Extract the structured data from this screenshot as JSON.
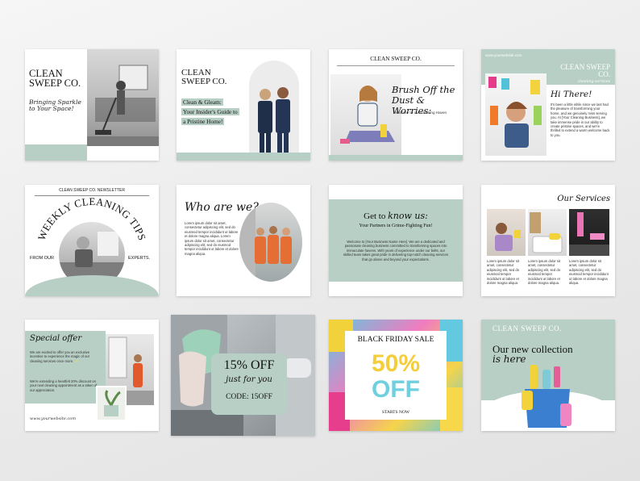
{
  "brand": "CLEAN SWEEP CO.",
  "brand_two_line": [
    "CLEAN",
    "SWEEP CO."
  ],
  "website": "www.yourwebsite.com",
  "colors": {
    "sage": "#b8cfc6",
    "dark": "#222222",
    "pink": "#f08cc8",
    "yellow": "#f6d44a",
    "teal": "#7fcfd9"
  },
  "cards": {
    "c1": {
      "tagline": [
        "Bringing Sparkle",
        "to Your Space!"
      ]
    },
    "c2": {
      "lines": [
        "Clean & Gleam:",
        "Your Insider's Guide to",
        "a Pristine Home!"
      ]
    },
    "c3": {
      "heading": [
        "Brush Off the",
        "Dust & Worries:"
      ],
      "sub": "Welcome to our Cleaning Haven"
    },
    "c4": {
      "website": "www.yourwebsite.com",
      "brand": [
        "CLEAN SWEEP",
        "CO."
      ],
      "sub": "cleaning services",
      "greeting": "Hi There!",
      "body": "It's been a little while since we last had the pleasure of transforming your home, and we genuinely miss serving you. At [Your Cleaning Business], we take immense pride in our ability to create pristine spaces, and we're thrilled to extend a warm welcome back to you."
    },
    "c5": {
      "header": "CLEAN SWEEP CO. NEWSLETTER",
      "arc_title": "WEEKLY CLEANING TIPS",
      "left": "FROM OUR",
      "right": "EXPERTS."
    },
    "c6": {
      "title": "Who are we?",
      "body": "Lorem ipsum dolor sit amet, consectetur adipiscing elit, sed do eiusmod tempor incididunt ut labore et dolore magna aliqua. Lorem ipsum dolor sit amet, consectetur adipiscing elit, sed do eiusmod tempor incididunt ut labore et dolore magna aliqua."
    },
    "c7": {
      "title_a": "Get to ",
      "title_b": "know us:",
      "sub": "Your Partners in Grime-Fighting Fun!",
      "body": "Welcome to [Your Business Name Here]. We are a dedicated and passionate cleaning business committed to transforming spaces into immaculate havens. With years of experience under our belts, our skilled team takes great pride in delivering top-notch cleaning services that go above and beyond your expectations."
    },
    "c8": {
      "title": "Our Services",
      "cols": [
        "Lorem ipsum dolor sit amet, consectetur adipiscing elit, sed do eiusmod tempor incididunt ut labore et dolore magna aliqua.",
        "Lorem ipsum dolor sit amet, consectetur adipiscing elit, sed do eiusmod tempor incididunt ut labore et dolore magna aliqua.",
        "Lorem ipsum dolor sit amet, consectetur adipiscing elit, sed do eiusmod tempor incididunt ut labore et dolore magna aliqua."
      ]
    },
    "c9": {
      "title": "Special offer",
      "p1": "We are excited to offer you an exclusive incentive to experience the magic of our cleaning services once more. ✨",
      "p2": "We're extending a heartfelt 20% discount on your next cleaning appointment as a token of our appreciation.",
      "website": "www.yourwebsite.com"
    },
    "c10": {
      "big": "15% OFF",
      "script": "just for you",
      "code": "CODE: 15OFF"
    },
    "c11": {
      "title": "BLACK FRIDAY SALE",
      "pct": "50%",
      "off": "OFF",
      "sub": "STARTS NOW"
    },
    "c12": {
      "brand": "CLEAN SWEEP CO.",
      "line1": "Our new collection",
      "line2": "is here"
    }
  }
}
